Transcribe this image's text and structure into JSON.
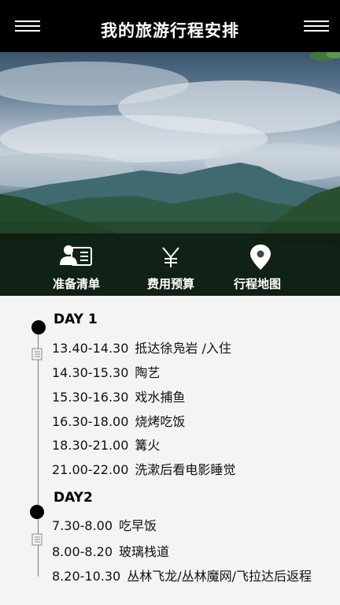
{
  "header": {
    "title": "我的旅游行程安排",
    "left_menu_icon": "hamburger-menu-icon",
    "right_menu_icon": "hamburger-menu-icon"
  },
  "actions": [
    {
      "label": "准备清单",
      "icon": "checklist-card-icon"
    },
    {
      "label": "费用预算",
      "icon": "yen-icon"
    },
    {
      "label": "行程地图",
      "icon": "map-pin-icon"
    }
  ],
  "timeline": {
    "days": [
      {
        "title": "DAY 1",
        "items": [
          {
            "time": "13.40-14.30",
            "activity": "抵达徐凫岩 /入住"
          },
          {
            "time": "14.30-15.30",
            "activity": "陶艺"
          },
          {
            "time": "15.30-16.30",
            "activity": "戏水捕鱼"
          },
          {
            "time": "16.30-18.00",
            "activity": "烧烤吃饭"
          },
          {
            "time": "18.30-21.00",
            "activity": "篝火"
          },
          {
            "time": "21.00-22.00",
            "activity": "洗漱后看电影睡觉"
          }
        ]
      },
      {
        "title": "DAY2",
        "items": [
          {
            "time": "7.30-8.00",
            "activity": "吃早饭"
          },
          {
            "time": "8.00-8.20",
            "activity": "玻璃栈道"
          },
          {
            "time": "8.20-10.30",
            "activity": "丛林飞龙/丛林魔网/飞拉达后返程"
          }
        ]
      }
    ]
  },
  "colors": {
    "header_bg": "#000000",
    "content_bg": "#f4f4f4",
    "dot": "#000000"
  }
}
